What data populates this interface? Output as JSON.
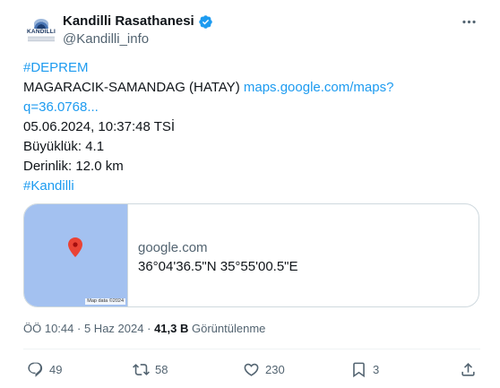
{
  "account": {
    "display_name": "Kandilli Rasathanesi",
    "handle": "@Kandilli_info",
    "avatar_text": "KANDILLI",
    "verified_color": "#1d9bf0"
  },
  "tweet": {
    "hashtag_1": "#DEPREM",
    "location": "MAGARACIK-SAMANDAG (HATAY)",
    "link_part_1": "maps.google.com/maps?",
    "link_part_2": "q=36.0768...",
    "datetime": "05.06.2024, 10:37:48 TSİ",
    "magnitude": "Büyüklük: 4.1",
    "depth": "Derinlik: 12.0 km",
    "hashtag_2": "#Kandilli"
  },
  "card": {
    "domain": "google.com",
    "title": "36°04'36.5\"N 35°55'00.5\"E",
    "map_credit": "Map data ©2024",
    "map_color": "#a3c1f0",
    "pin_color": "#ea4335"
  },
  "meta": {
    "time": "ÖÖ 10:44",
    "separator_1": "·",
    "date": "5 Haz 2024",
    "separator_2": "·",
    "views_count": "41,3 B",
    "views_label": "Görüntülenme"
  },
  "actions": {
    "replies": "49",
    "reposts": "58",
    "likes": "230",
    "bookmarks": "3"
  },
  "colors": {
    "link": "#1d9bf0",
    "secondary_text": "#536471",
    "border": "#cfd9de"
  }
}
